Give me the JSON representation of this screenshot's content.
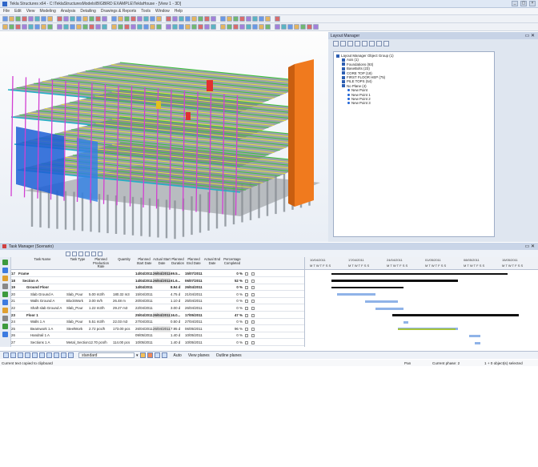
{
  "app": {
    "title": "Tekla Structures x64 - C:\\TeklaStructuresModels\\BIGBIRD EXAMPLE\\TeklaHouse - [View 1 - 3D]",
    "window_controls": [
      "_",
      "▢",
      "×"
    ]
  },
  "menu": [
    "File",
    "Edit",
    "View",
    "Modeling",
    "Analysis",
    "Detailing",
    "Drawings & Reports",
    "Tools",
    "Window",
    "Help"
  ],
  "layout_manager": {
    "title": "Layout Manager",
    "tree": [
      {
        "label": "Layout Manager Object Group (1)",
        "level": 0,
        "kind": "group"
      },
      {
        "label": "Axis (1)",
        "level": 1,
        "kind": "group"
      },
      {
        "label": "Foundations (93)",
        "level": 1,
        "kind": "group"
      },
      {
        "label": "BaseBolts (23)",
        "level": 1,
        "kind": "group"
      },
      {
        "label": "CORE TOP (18)",
        "level": 1,
        "kind": "group"
      },
      {
        "label": "FIRST FLOOR HEP (75)",
        "level": 1,
        "kind": "group"
      },
      {
        "label": "PILE TOPS (54)",
        "level": 1,
        "kind": "group"
      },
      {
        "label": "No Plane (4)",
        "level": 1,
        "kind": "group"
      },
      {
        "label": "New Point",
        "level": 2,
        "kind": "point"
      },
      {
        "label": "New Point 1",
        "level": 2,
        "kind": "point"
      },
      {
        "label": "New Point 2",
        "level": 2,
        "kind": "point"
      },
      {
        "label": "New Point 3",
        "level": 2,
        "kind": "point"
      }
    ]
  },
  "task_manager": {
    "title": "Task Manager (Scenario)",
    "columns": {
      "num": "",
      "name": "Task Name",
      "type": "Task Type",
      "rate": "Planned Production Rate",
      "qty": "Quantity",
      "pstart": "Planned Start Date",
      "astart": "Actual Start Date",
      "pdur": "Planned Duration",
      "pend": "Planned End Date",
      "aend": "Actual End Date",
      "pct": "Percentage Completed"
    },
    "rows": [
      {
        "num": "17",
        "name": "Frame",
        "type": "",
        "rate": "",
        "qty": "",
        "pstart": "14/04/2011",
        "astart": "26/04/2011",
        "pdur": "69.5...",
        "pend": "15/07/2011",
        "aend": "",
        "pct": "0 %",
        "bold": true,
        "indent": 0
      },
      {
        "num": "18",
        "name": "Section A",
        "type": "",
        "rate": "",
        "qty": "",
        "pstart": "14/04/2011",
        "astart": "26/04/2011",
        "pdur": "61.6...",
        "pend": "06/07/2011",
        "aend": "",
        "pct": "52 %",
        "bold": true,
        "indent": 1
      },
      {
        "num": "19",
        "name": "Ground Floor",
        "type": "",
        "rate": "",
        "qty": "",
        "pstart": "14/04/2011",
        "astart": "",
        "pdur": "8.94 d",
        "pend": "26/04/2011",
        "aend": "",
        "pct": "0 %",
        "bold": true,
        "indent": 2
      },
      {
        "num": "20",
        "name": "Slab Ground A",
        "type": "Slab_Pour",
        "rate": "5.00 m3/h",
        "qty": "180.32 m3",
        "pstart": "15/04/2011",
        "astart": "",
        "pdur": "4.75 d",
        "pend": "21/04/2011",
        "aend": "",
        "pct": "0 %",
        "bold": false,
        "indent": 3
      },
      {
        "num": "21",
        "name": "Walls Ground A",
        "type": "BlockWork",
        "rate": "3.00 m/h",
        "qty": "26.48 m",
        "pstart": "20/04/2011",
        "astart": "",
        "pdur": "1.10 d",
        "pend": "25/04/2011",
        "aend": "",
        "pct": "0 %",
        "bold": false,
        "indent": 3
      },
      {
        "num": "22",
        "name": "Shaft slab Ground A",
        "type": "Slab_Pour",
        "rate": "1.22 m3/h",
        "qty": "29.27 m3",
        "pstart": "22/04/2011",
        "astart": "",
        "pdur": "3.00 d",
        "pend": "26/04/2011",
        "aend": "",
        "pct": "0 %",
        "bold": false,
        "indent": 3
      },
      {
        "num": "23",
        "name": "Floor 1",
        "type": "",
        "rate": "",
        "qty": "",
        "pstart": "25/04/2011",
        "astart": "26/04/2011",
        "pdur": "16.0...",
        "pend": "17/05/2011",
        "aend": "",
        "pct": "47 %",
        "bold": true,
        "indent": 2
      },
      {
        "num": "24",
        "name": "Walls 1 A",
        "type": "Slab_Pour",
        "rate": "5.51 m3/h",
        "qty": "22.03 m3",
        "pstart": "27/04/2011",
        "astart": "",
        "pdur": "0.50 d",
        "pend": "27/04/2011",
        "aend": "",
        "pct": "0 %",
        "bold": false,
        "indent": 3
      },
      {
        "num": "25",
        "name": "Beamwork 1 A",
        "type": "SteelWork",
        "rate": "2.72 pcs/h",
        "qty": "173.00 pcs",
        "pstart": "26/04/2011",
        "astart": "26/04/2011",
        "pdur": "7.95 d",
        "pend": "06/05/2011",
        "aend": "",
        "pct": "96 %",
        "bold": false,
        "indent": 3
      },
      {
        "num": "26",
        "name": "Handrail 1 A",
        "type": "",
        "rate": "",
        "qty": "",
        "pstart": "09/05/2011",
        "astart": "",
        "pdur": "1.40 d",
        "pend": "10/05/2011",
        "aend": "",
        "pct": "0 %",
        "bold": false,
        "indent": 3
      },
      {
        "num": "27",
        "name": "Sections 1 A",
        "type": "Metal_Sections",
        "rate": "12.70 pcs/h",
        "qty": "114.00 pcs",
        "pstart": "10/05/2011",
        "astart": "",
        "pdur": "1.40 d",
        "pend": "10/05/2011",
        "aend": "",
        "pct": "0 %",
        "bold": false,
        "indent": 3
      }
    ],
    "gantt_dates": [
      "10/04/2011",
      "17/04/2011",
      "24/04/2011",
      "01/05/2011",
      "08/05/2011",
      "15/05/2011"
    ],
    "gantt_weekdays": "M T W T F S S"
  },
  "bottom_toolbar": {
    "style_select": "standard",
    "mode_label": "Auto",
    "view_planes": "View planes",
    "outline_planes": "Outline planes"
  },
  "status": {
    "clipboard": "Current text copied to clipboard",
    "pan": "Pan",
    "phase": "Current phase: 2",
    "selected": "1 + 0 object(s) selected"
  },
  "colors": {
    "summary_bar": "#111111",
    "task_bar": "#8fb3e8",
    "progress_bar": "#a7c43a",
    "model_orange": "#f07a1e",
    "model_green": "#3cc43c",
    "model_magenta": "#d23fd2"
  }
}
